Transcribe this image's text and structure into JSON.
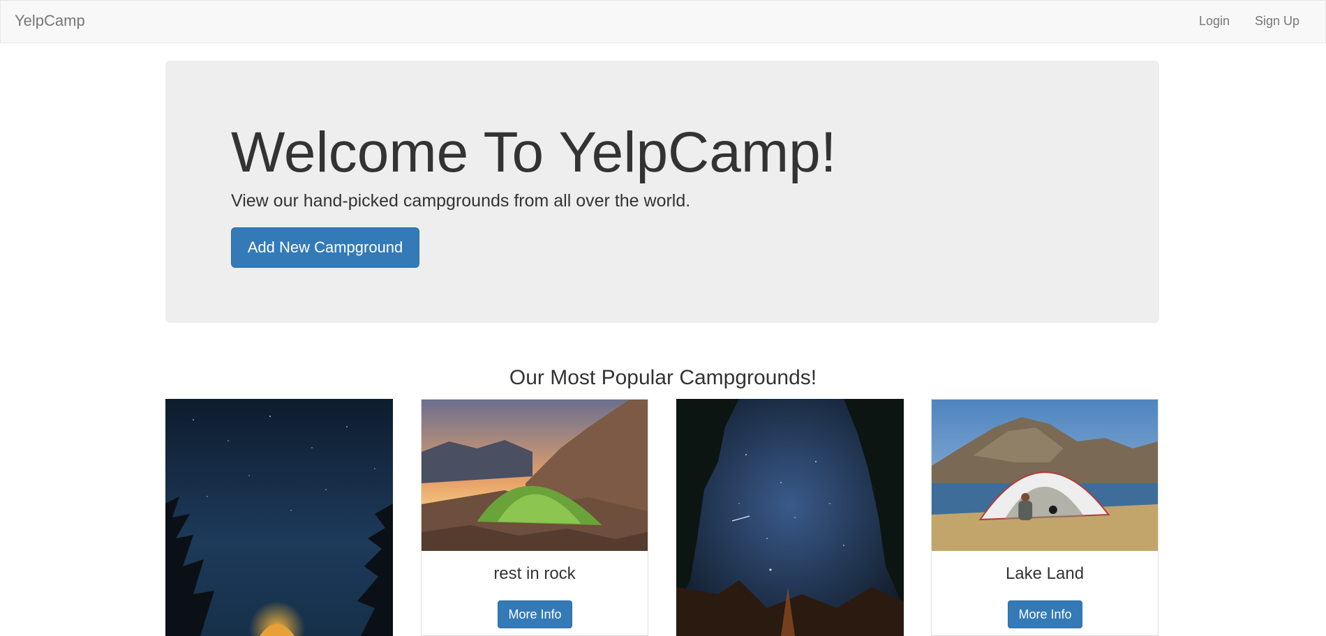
{
  "navbar": {
    "brand": "YelpCamp",
    "links": [
      {
        "label": "Login"
      },
      {
        "label": "Sign Up"
      }
    ]
  },
  "jumbotron": {
    "title": "Welcome To YelpCamp!",
    "subtitle": "View our hand-picked campgrounds from all over the world.",
    "button_label": "Add New Campground"
  },
  "section": {
    "title": "Our Most Popular Campgrounds!"
  },
  "campgrounds": [
    {
      "name": "",
      "button_label": ""
    },
    {
      "name": "rest in rock",
      "button_label": "More Info"
    },
    {
      "name": "",
      "button_label": ""
    },
    {
      "name": "Lake Land",
      "button_label": "More Info"
    }
  ],
  "colors": {
    "primary": "#337ab7",
    "navbar_bg": "#f8f8f8",
    "jumbotron_bg": "#eeeeee"
  }
}
